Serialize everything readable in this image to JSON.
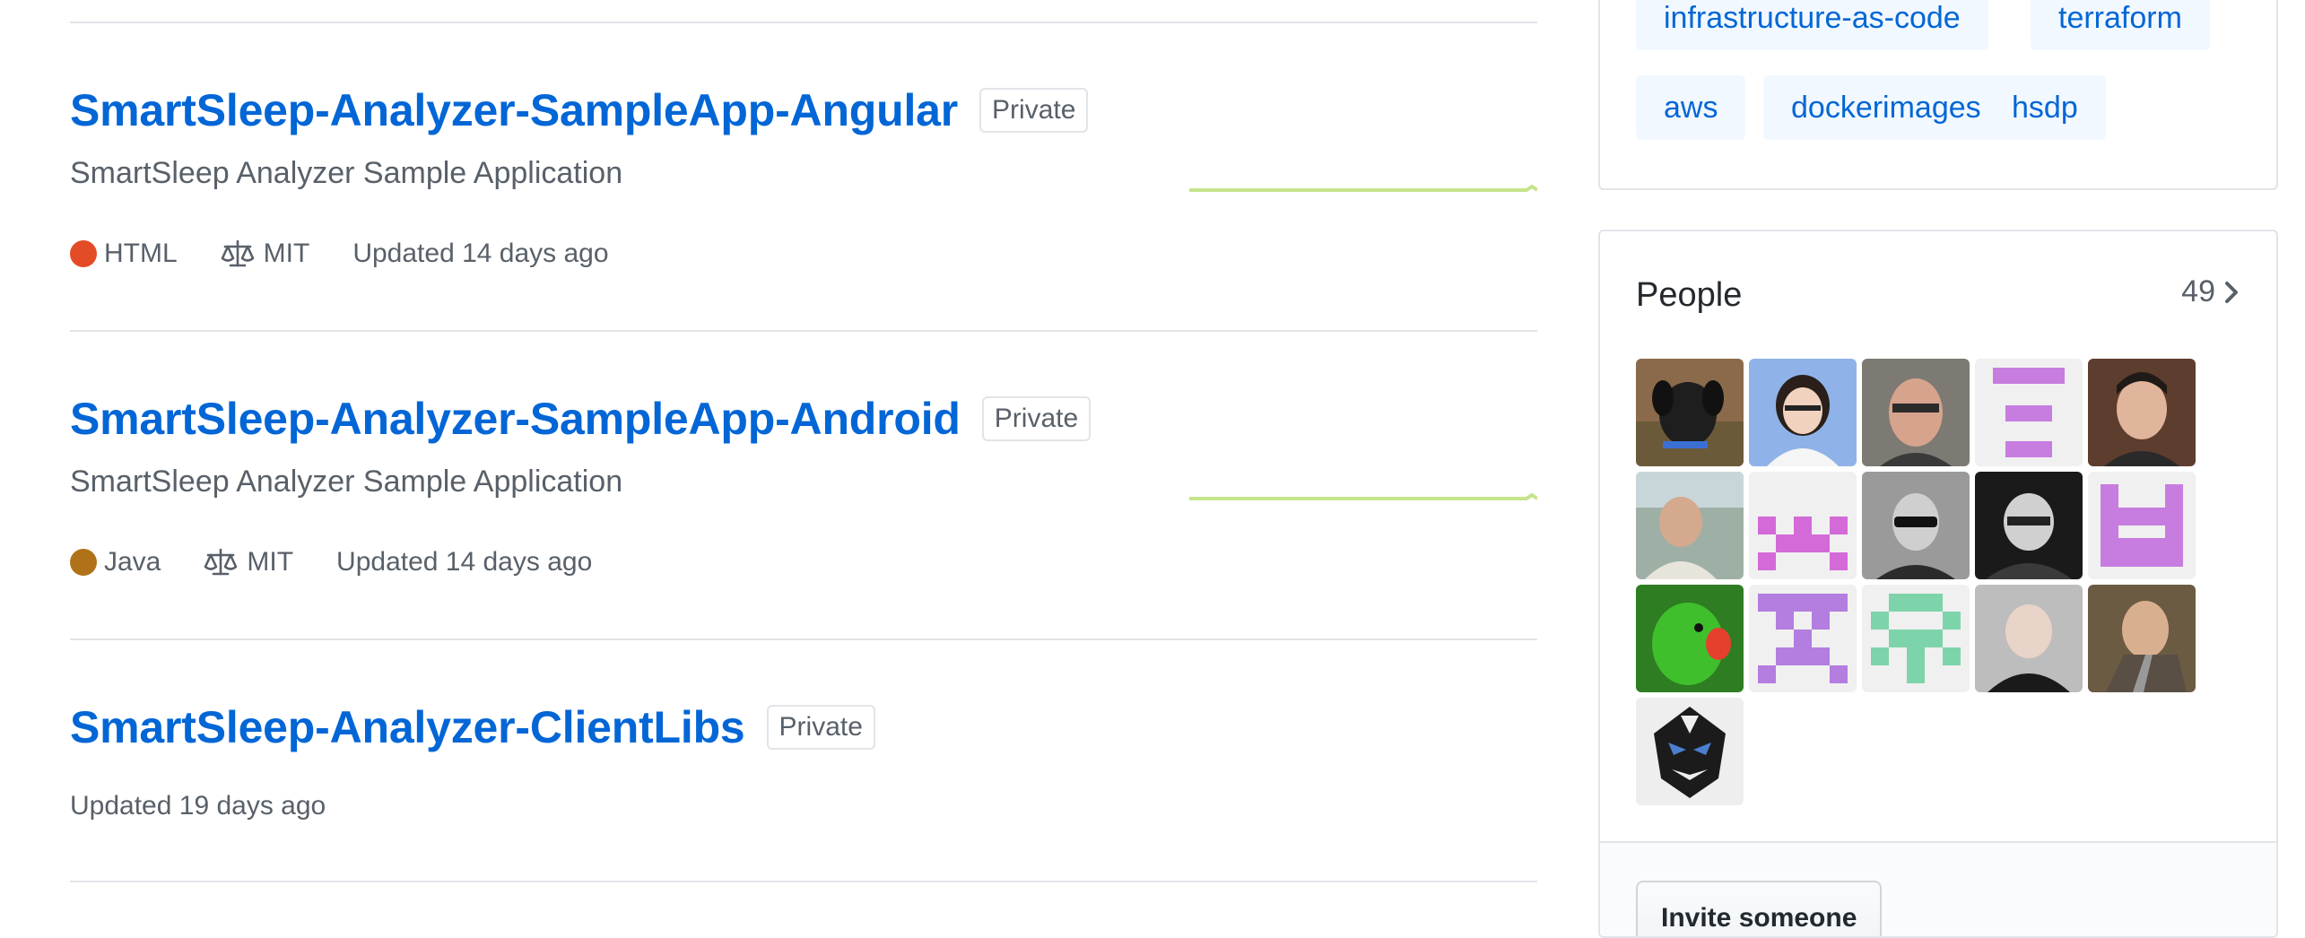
{
  "repositories": [
    {
      "name": "SmartSleep-Analyzer-SampleApp-Angular",
      "visibility": "Private",
      "description": "SmartSleep Analyzer Sample Application",
      "language": "HTML",
      "language_color": "#e34c26",
      "license": "MIT",
      "updated": "Updated 14 days ago"
    },
    {
      "name": "SmartSleep-Analyzer-SampleApp-Android",
      "visibility": "Private",
      "description": "SmartSleep Analyzer Sample Application",
      "language": "Java",
      "language_color": "#b07219",
      "license": "MIT",
      "updated": "Updated 14 days ago"
    },
    {
      "name": "SmartSleep-Analyzer-ClientLibs",
      "visibility": "Private",
      "updated": "Updated 19 days ago"
    }
  ],
  "topics": [
    "infrastructure-as-code",
    "terraform",
    "aws",
    "dockerimages",
    "hsdp"
  ],
  "people": {
    "title": "People",
    "count": "49",
    "avatar_count": 16,
    "invite_label": "Invite someone"
  },
  "colors": {
    "link": "#0366d6",
    "topic_bg": "#f1f8ff",
    "sparkline": "#c6e48b"
  },
  "icons": {
    "license": "law-icon",
    "people_more": "chevron-right-icon"
  }
}
